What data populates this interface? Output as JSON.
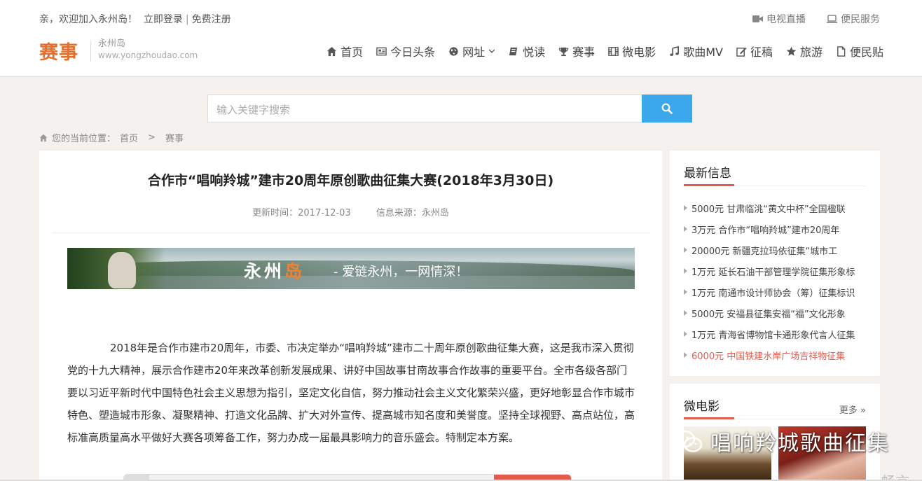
{
  "topbar": {
    "welcome": "亲，欢迎加入永州岛！",
    "login": "立即登录",
    "sep": "|",
    "register": "免费注册",
    "tv_live": "电视直播",
    "services": "便民服务"
  },
  "logo": {
    "title": "赛事",
    "name": "永州岛",
    "url": "www.yongzhoudao.com"
  },
  "nav": {
    "items": [
      {
        "label": "首页",
        "icon": "home-icon"
      },
      {
        "label": "今日头条",
        "icon": "newspaper-icon"
      },
      {
        "label": "网址",
        "icon": "globe-icon"
      },
      {
        "label": "悦读",
        "icon": "book-icon"
      },
      {
        "label": "赛事",
        "icon": "trophy-icon"
      },
      {
        "label": "微电影",
        "icon": "film-icon"
      },
      {
        "label": "歌曲MV",
        "icon": "music-icon"
      },
      {
        "label": "征稿",
        "icon": "edit-icon"
      },
      {
        "label": "旅游",
        "icon": "star-icon"
      },
      {
        "label": "便民贴",
        "icon": "file-icon"
      }
    ]
  },
  "search": {
    "placeholder": "输入关键字搜索"
  },
  "breadcrumb": {
    "prefix": "您的当前位置：",
    "home": "首页",
    "gt": ">",
    "current": "赛事"
  },
  "article": {
    "title": "合作市“唱响羚城”建市20周年原创歌曲征集大赛(2018年3月30日)",
    "updated": "更新时间：2017-12-03",
    "source": "信息来源：永州岛",
    "banner_main_a": "永州",
    "banner_main_b": "岛",
    "banner_tag": "- 爱链永州，一网情深！",
    "body": "2018年是合作市建市20周年，市委、市决定举办“唱响羚城”建市二十周年原创歌曲征集大赛，这是我市深入贯彻党的十九大精神，展示合作建市20年来改革创新发展成果、讲好中国故事甘南故事合作故事的重要平台。全市各级各部门要以习近平新时代中国特色社会主义思想为指引，坚定文化自信，努力推动社会主义文化繁荣兴盛，更好地彰显合作市城市特色、塑造城市形象、凝聚精神、打造文化品牌、扩大对外宣传、提高城市知名度和美誉度。坚持全球视野、高点站位，高标准高质量高水平做好大赛各项筹备工作，努力办成一届最具影响力的音乐盛会。特制定本方案。"
  },
  "sidebar": {
    "latest_title": "最新信息",
    "latest": [
      "5000元 甘肃临洮“黄文中杯”全国楹联",
      "3万元 合作市“唱响羚城”建市20周年",
      "20000元 新疆克拉玛依征集“城市工",
      "1万元 延长石油干部管理学院征集形象标",
      "1万元 南通市设计师协会（筹）征集标识",
      "5000元 安福县征集安福“福”文化形象",
      "1万元 青海省博物馆卡通形象代言人征集",
      "6000元 中国铁建水岸广场吉祥物征集"
    ],
    "micro_title": "微电影",
    "more": "更多",
    "more_icon": "double-chevron-right-icon"
  },
  "watermark": {
    "text": "唱响羚城歌曲征集",
    "corner": "畅言"
  },
  "colors": {
    "brand_orange": "#e07130",
    "accent_red": "#e35b4c",
    "search_blue": "#3aa8ea"
  }
}
